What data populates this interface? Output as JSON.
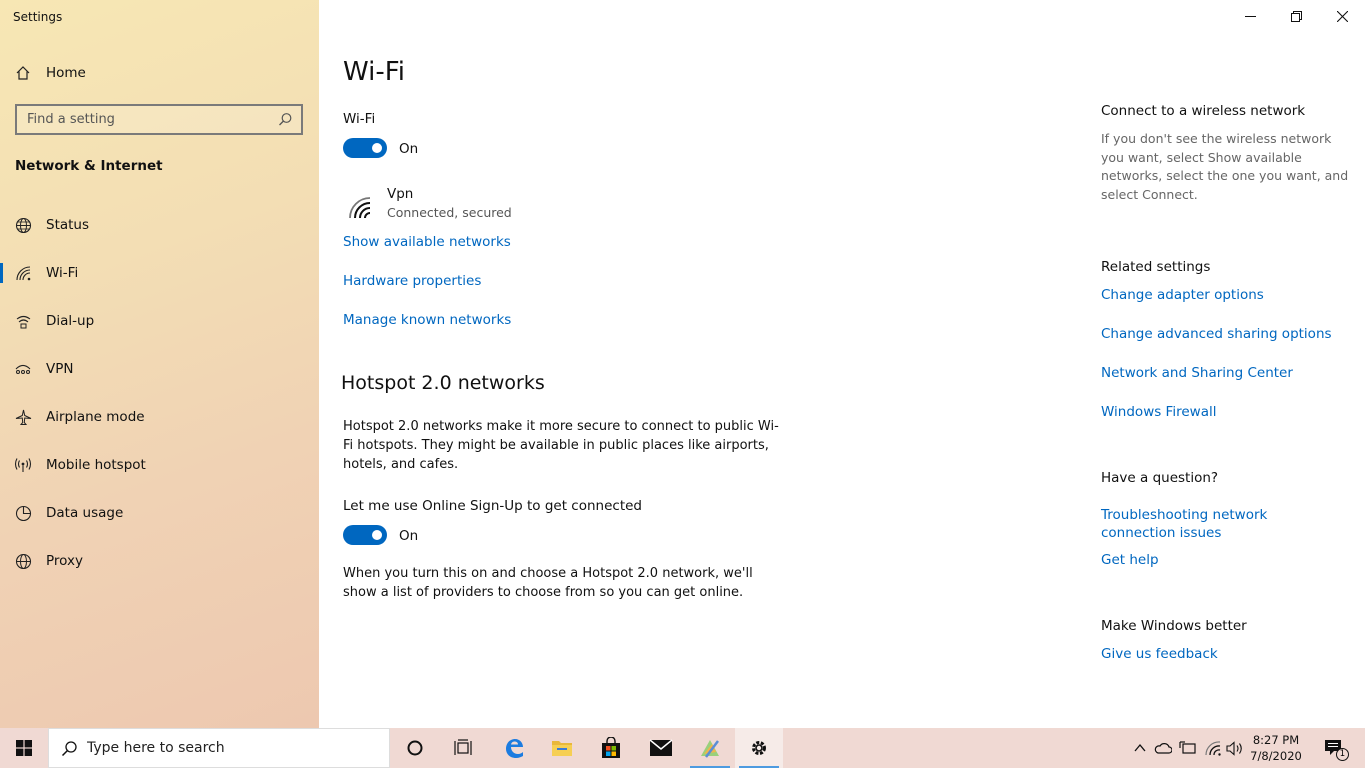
{
  "app": {
    "title": "Settings"
  },
  "sidebar": {
    "home_label": "Home",
    "search_placeholder": "Find a setting",
    "section_title": "Network & Internet",
    "items": [
      {
        "label": "Status",
        "icon": "globe-icon"
      },
      {
        "label": "Wi-Fi",
        "icon": "wifi-icon",
        "active": true
      },
      {
        "label": "Dial-up",
        "icon": "dialup-icon"
      },
      {
        "label": "VPN",
        "icon": "vpn-icon"
      },
      {
        "label": "Airplane mode",
        "icon": "airplane-icon"
      },
      {
        "label": "Mobile hotspot",
        "icon": "hotspot-icon"
      },
      {
        "label": "Data usage",
        "icon": "data-usage-icon"
      },
      {
        "label": "Proxy",
        "icon": "globe-icon"
      }
    ]
  },
  "main": {
    "title": "Wi-Fi",
    "wifi_label": "Wi-Fi",
    "wifi_state": "On",
    "network": {
      "name": "Vpn",
      "status": "Connected, secured"
    },
    "links": {
      "show_available": "Show available networks",
      "hardware": "Hardware properties",
      "manage_known": "Manage known networks"
    },
    "hotspot": {
      "title": "Hotspot 2.0 networks",
      "description": "Hotspot 2.0 networks make it more secure to connect to public Wi-Fi hotspots. They might be available in public places like airports, hotels, and cafes.",
      "signup_label": "Let me use Online Sign-Up to get connected",
      "signup_state": "On",
      "footnote": "When you turn this on and choose a Hotspot 2.0 network, we'll show a list of providers to choose from so you can get online."
    }
  },
  "right": {
    "connect_title": "Connect to a wireless network",
    "connect_text": "If you don't see the wireless network you want, select Show available networks, select the one you want, and select Connect.",
    "related_title": "Related settings",
    "related_links": [
      "Change adapter options",
      "Change advanced sharing options",
      "Network and Sharing Center",
      "Windows Firewall"
    ],
    "question_title": "Have a question?",
    "question_links": [
      "Troubleshooting network connection issues",
      "Get help"
    ],
    "better_title": "Make Windows better",
    "feedback_link": "Give us feedback"
  },
  "taskbar": {
    "search_placeholder": "Type here to search",
    "time": "8:27 PM",
    "date": "7/8/2020",
    "notification_count": "1"
  },
  "colors": {
    "accent": "#0067c0",
    "link": "#0067c0"
  }
}
